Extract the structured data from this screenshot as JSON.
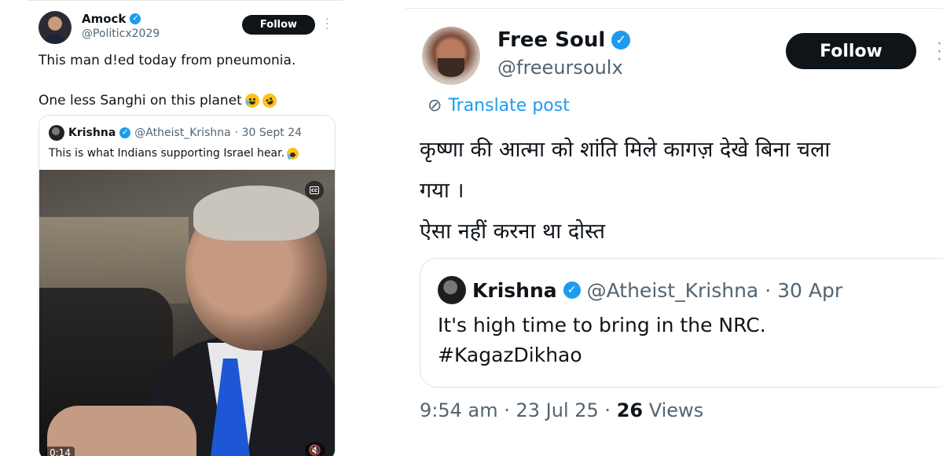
{
  "left_tweet": {
    "author": {
      "name": "Amock",
      "handle": "@Politicx2029",
      "verified": true
    },
    "follow_label": "Follow",
    "text_line1": "This man d!ed today from pneumonia.",
    "text_line2": "One less Sanghi on this planet",
    "emojis": [
      "crying-laughing-emoji",
      "rolling-laughing-emoji"
    ],
    "quoted": {
      "author": {
        "name": "Krishna",
        "handle": "@Atheist_Krishna",
        "verified": true
      },
      "date": "· 30 Sept 24",
      "text": "This is what Indians supporting Israel hear.",
      "video": {
        "duration": "0:14",
        "cc_label": "cc"
      }
    }
  },
  "right_tweet": {
    "author": {
      "name": "Free Soul",
      "handle": "@freeursoulx",
      "verified": true
    },
    "follow_label": "Follow",
    "translate_label": "Translate post",
    "body_line1": "कृष्णा की आत्मा को शांति मिले कागज़ देखे बिना चला",
    "body_line2": "गया ।",
    "body_line3": "ऐसा नहीं करना था दोस्त",
    "quoted": {
      "author": {
        "name": "Krishna",
        "handle": "@Atheist_Krishna",
        "verified": true
      },
      "date": "· 30 Apr",
      "line1": "It's high time to bring in the NRC.",
      "line2": "#KagazDikhao"
    },
    "meta": {
      "time": "9:54 am",
      "date": "23 Jul 25",
      "views_count": "26",
      "views_label": "Views"
    }
  },
  "colors": {
    "accent": "#1d9bf0",
    "text": "#0f1419",
    "muted": "#536471",
    "border": "#dfe4e8",
    "button": "#0f1419"
  }
}
